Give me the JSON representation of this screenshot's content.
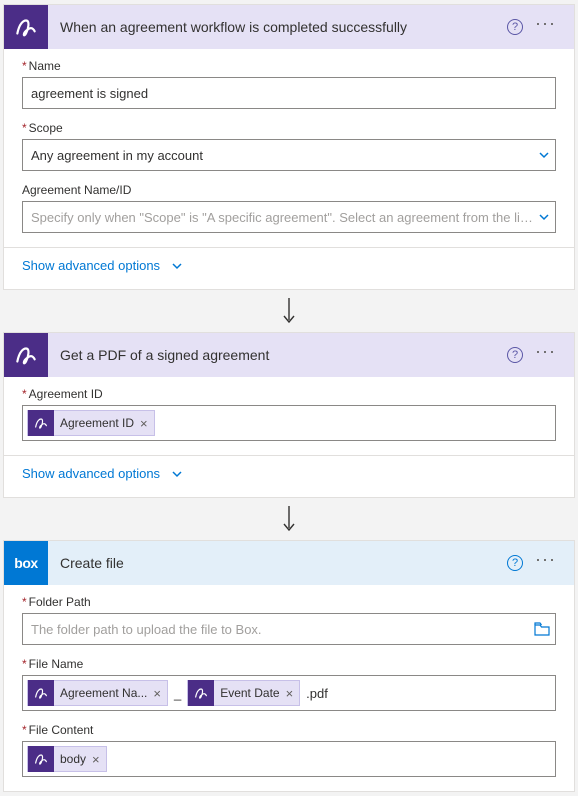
{
  "step1": {
    "title": "When an agreement workflow is completed successfully",
    "name_label": "Name",
    "name_value": "agreement is signed",
    "scope_label": "Scope",
    "scope_value": "Any agreement in my account",
    "agreement_label": "Agreement Name/ID",
    "agreement_placeholder": "Specify only when \"Scope\" is \"A specific agreement\". Select an agreement from the list or en",
    "advanced": "Show advanced options"
  },
  "step2": {
    "title": "Get a PDF of a signed agreement",
    "agreement_id_label": "Agreement ID",
    "token_agreement_id": "Agreement ID",
    "advanced": "Show advanced options"
  },
  "step3": {
    "title": "Create file",
    "box_logo_text": "box",
    "folder_label": "Folder Path",
    "folder_placeholder": "The folder path to upload the file to Box.",
    "filename_label": "File Name",
    "token_agreement_name": "Agreement Na...",
    "literal_sep": "_",
    "token_event_date": "Event Date",
    "literal_ext": ".pdf",
    "filecontent_label": "File Content",
    "token_body": "body"
  }
}
